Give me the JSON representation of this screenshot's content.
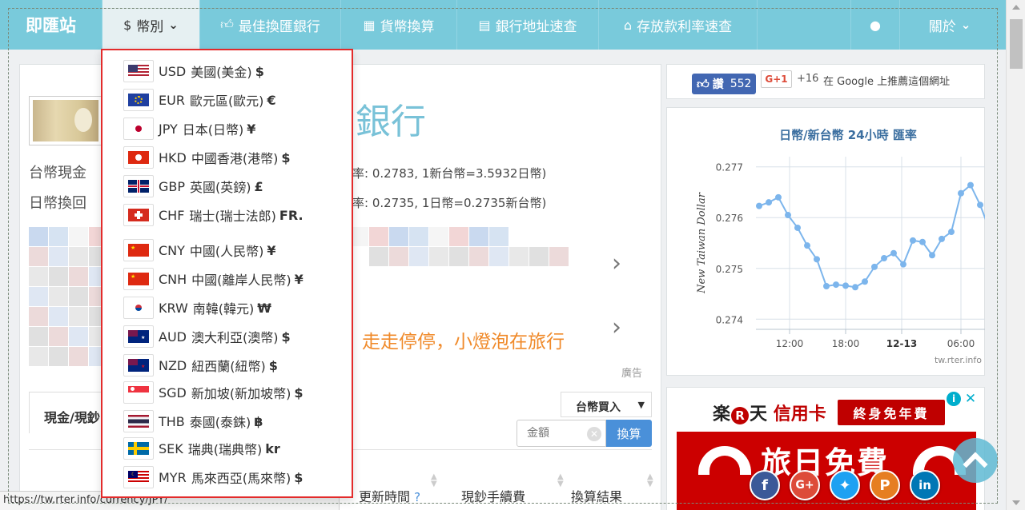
{
  "nav": {
    "brand": "即匯站",
    "currency_label": "幣別",
    "items": [
      {
        "label": "最佳換匯銀行",
        "icon": "thumbs-up-icon"
      },
      {
        "label": "貨幣換算",
        "icon": "calculator-icon"
      },
      {
        "label": "銀行地址速查",
        "icon": "book-icon"
      },
      {
        "label": "存放款利率速查",
        "icon": "bank-icon"
      }
    ],
    "globe_icon": "globe-icon",
    "about_label": "關於"
  },
  "currency_menu": [
    {
      "code": "USD",
      "name": "美國(美金)",
      "symbol": "$",
      "flag": "us-flag"
    },
    {
      "code": "EUR",
      "name": "歐元區(歐元)",
      "symbol": "€",
      "flag": "eu-flag"
    },
    {
      "code": "JPY",
      "name": "日本(日幣)",
      "symbol": "¥",
      "flag": "jp-flag"
    },
    {
      "code": "HKD",
      "name": "中國香港(港幣)",
      "symbol": "$",
      "flag": "hk-flag"
    },
    {
      "code": "GBP",
      "name": "英國(英鎊)",
      "symbol": "£",
      "flag": "gb-flag"
    },
    {
      "code": "CHF",
      "name": "瑞士(瑞士法郎)",
      "symbol": "FR.",
      "flag": "ch-flag"
    },
    {
      "code": "CNY",
      "name": "中國(人民幣)",
      "symbol": "¥",
      "flag": "cn-flag"
    },
    {
      "code": "CNH",
      "name": "中國(離岸人民幣)",
      "symbol": "¥",
      "flag": "cn-flag"
    },
    {
      "code": "KRW",
      "name": "南韓(韓元)",
      "symbol": "₩",
      "flag": "kr-flag"
    },
    {
      "code": "AUD",
      "name": "澳大利亞(澳幣)",
      "symbol": "$",
      "flag": "au-flag"
    },
    {
      "code": "NZD",
      "name": "紐西蘭(紐幣)",
      "symbol": "$",
      "flag": "nz-flag"
    },
    {
      "code": "SGD",
      "name": "新加坡(新加坡幣)",
      "symbol": "$",
      "flag": "sg-flag"
    },
    {
      "code": "THB",
      "name": "泰國(泰銖)",
      "symbol": "฿",
      "flag": "th-flag"
    },
    {
      "code": "SEK",
      "name": "瑞典(瑞典幣)",
      "symbol": "kr",
      "flag": "se-flag"
    },
    {
      "code": "MYR",
      "name": "馬來西亞(馬來幣)",
      "symbol": "$",
      "flag": "my-flag"
    }
  ],
  "main": {
    "title_suffix": "銀行",
    "rate_line_1": "台幣現金",
    "rate_line_1_tail": "率: 0.2783, 1新台幣=3.5932日幣)",
    "rate_line_2": "日幣換回",
    "rate_line_2_tail": "率: 0.2735, 1日幣=0.2735新台幣)",
    "ad_text": "走走停停，小燈泡在旅行",
    "ad_label": "廣告",
    "tab_cash": "現金/現鈔",
    "direction_select": "台幣買入",
    "amount_placeholder": "金額",
    "convert_button": "換算",
    "table_headers": [
      "更新時間",
      "現鈔手續費",
      "換算結果"
    ],
    "help_icon": "?"
  },
  "status_url": "https://tw.rter.info/currency/JPY/",
  "social": {
    "fb_like_label": "讚",
    "fb_like_count": "552",
    "gplus_label": "G+1",
    "gplus_count": "+16",
    "gplus_text": "在 Google 上推薦這個網址"
  },
  "chart_data": {
    "type": "line",
    "title": "日幣/新台幣 24小時 匯率",
    "ylabel": "New Taiwan Dollar",
    "x_ticks": [
      "12:00",
      "18:00",
      "12-13",
      "06:00"
    ],
    "y_ticks": [
      0.274,
      0.275,
      0.276,
      0.277
    ],
    "ylim": [
      0.2738,
      0.2772
    ],
    "values": [
      0.27623,
      0.2763,
      0.2764,
      0.27605,
      0.2758,
      0.27545,
      0.27518,
      0.27465,
      0.27468,
      0.27466,
      0.27463,
      0.27474,
      0.27503,
      0.2752,
      0.2753,
      0.27508,
      0.27555,
      0.27552,
      0.27526,
      0.27558,
      0.27572,
      0.27648,
      0.27664,
      0.27625,
      0.27575
    ],
    "color": "#7cb5ec",
    "credit": "tw.rter.info"
  },
  "ad2": {
    "brand_left": "楽",
    "brand_r": "R",
    "brand_right": "天",
    "brand_card": "信用卡",
    "badge": "終身免年費",
    "headline": "旅日免費",
    "info_icon": "i",
    "close_icon": "✕"
  },
  "colors": {
    "nav": "#79cadb",
    "accent": "#4a90d9",
    "menu_border": "#e32b2b"
  }
}
